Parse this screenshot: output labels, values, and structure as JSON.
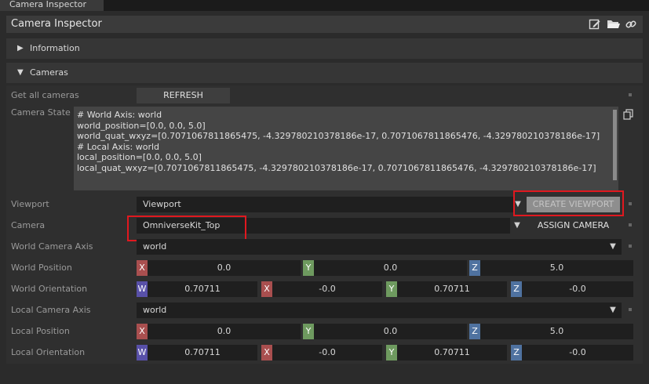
{
  "tab": {
    "label": "Camera Inspector"
  },
  "window": {
    "title": "Camera Inspector"
  },
  "sections": {
    "information": "Information",
    "cameras": "Cameras"
  },
  "rows": {
    "get_all_cameras": {
      "label": "Get all cameras",
      "button": "REFRESH"
    },
    "camera_state": {
      "label": "Camera State",
      "lines": [
        "# World Axis: world",
        "world_position=[0.0, 0.0, 5.0]",
        "world_quat_wxyz=[0.7071067811865475, -4.329780210378186e-17, 0.7071067811865476, -4.329780210378186e-17]",
        "# Local Axis: world",
        "local_position=[0.0, 0.0, 5.0]",
        "local_quat_wxyz=[0.7071067811865475, -4.329780210378186e-17, 0.7071067811865476, -4.329780210378186e-17]"
      ]
    },
    "viewport": {
      "label": "Viewport",
      "value": "Viewport",
      "button": "CREATE VIEWPORT"
    },
    "camera": {
      "label": "Camera",
      "value": "OmniverseKit_Top",
      "button": "ASSIGN CAMERA"
    },
    "world_camera_axis": {
      "label": "World Camera Axis",
      "value": "world"
    },
    "world_position": {
      "label": "World Position",
      "x": "0.0",
      "y": "0.0",
      "z": "5.0"
    },
    "world_orientation": {
      "label": "World Orientation",
      "w": "0.70711",
      "x": "-0.0",
      "y": "0.70711",
      "z": "-0.0"
    },
    "local_camera_axis": {
      "label": "Local Camera Axis",
      "value": "world"
    },
    "local_position": {
      "label": "Local Position",
      "x": "0.0",
      "y": "0.0",
      "z": "5.0"
    },
    "local_orientation": {
      "label": "Local Orientation",
      "w": "0.70711",
      "x": "-0.0",
      "y": "0.70711",
      "z": "-0.0"
    }
  },
  "axis_letters": {
    "x": "X",
    "y": "Y",
    "z": "Z",
    "w": "W"
  },
  "icons": [
    "edit-icon",
    "folder-icon",
    "link-icon",
    "copy-icon",
    "triangle-right-icon",
    "triangle-down-icon",
    "dropdown-arrow-icon"
  ],
  "colors": {
    "highlight": "#e0181f",
    "axis_x": "#a94f4f",
    "axis_y": "#6e9a5f",
    "axis_z": "#4f72a0",
    "axis_w": "#5850a8"
  }
}
